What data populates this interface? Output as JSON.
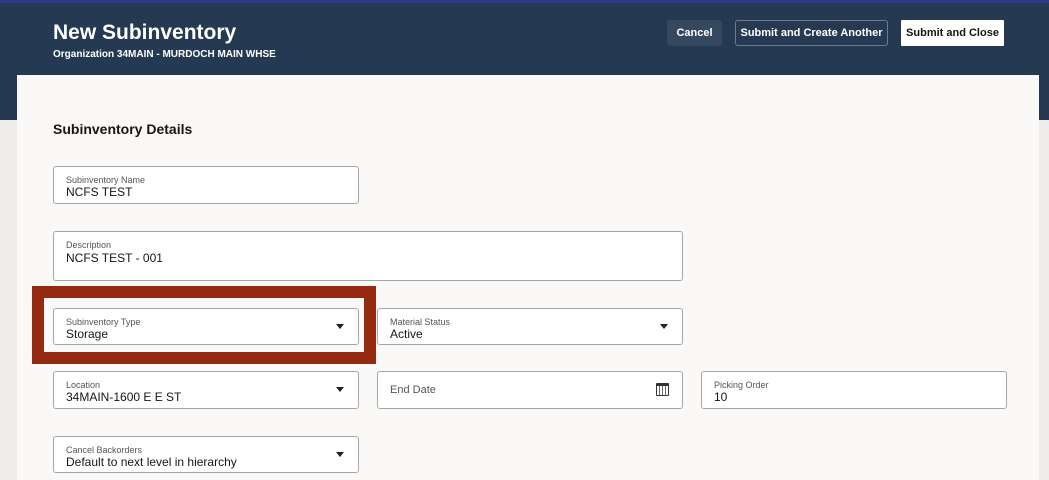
{
  "header": {
    "title": "New Subinventory",
    "subtitle": "Organization 34MAIN - MURDOCH MAIN WHSE",
    "cancel": "Cancel",
    "submit_another": "Submit and Create Another",
    "submit_close": "Submit and Close"
  },
  "section": "Subinventory Details",
  "fields": {
    "name": {
      "label": "Subinventory Name",
      "value": "NCFS TEST"
    },
    "description": {
      "label": "Description",
      "value": "NCFS TEST - 001"
    },
    "type": {
      "label": "Subinventory Type",
      "value": "Storage"
    },
    "material_status": {
      "label": "Material Status",
      "value": "Active"
    },
    "location": {
      "label": "Location",
      "value": "34MAIN-1600 E E ST"
    },
    "end_date": {
      "placeholder": "End Date"
    },
    "picking_order": {
      "label": "Picking Order",
      "value": "10"
    },
    "cancel_backorders": {
      "label": "Cancel Backorders",
      "value": "Default to next level in hierarchy"
    }
  },
  "colors": {
    "header": "#253a52",
    "highlight": "#962a10"
  }
}
